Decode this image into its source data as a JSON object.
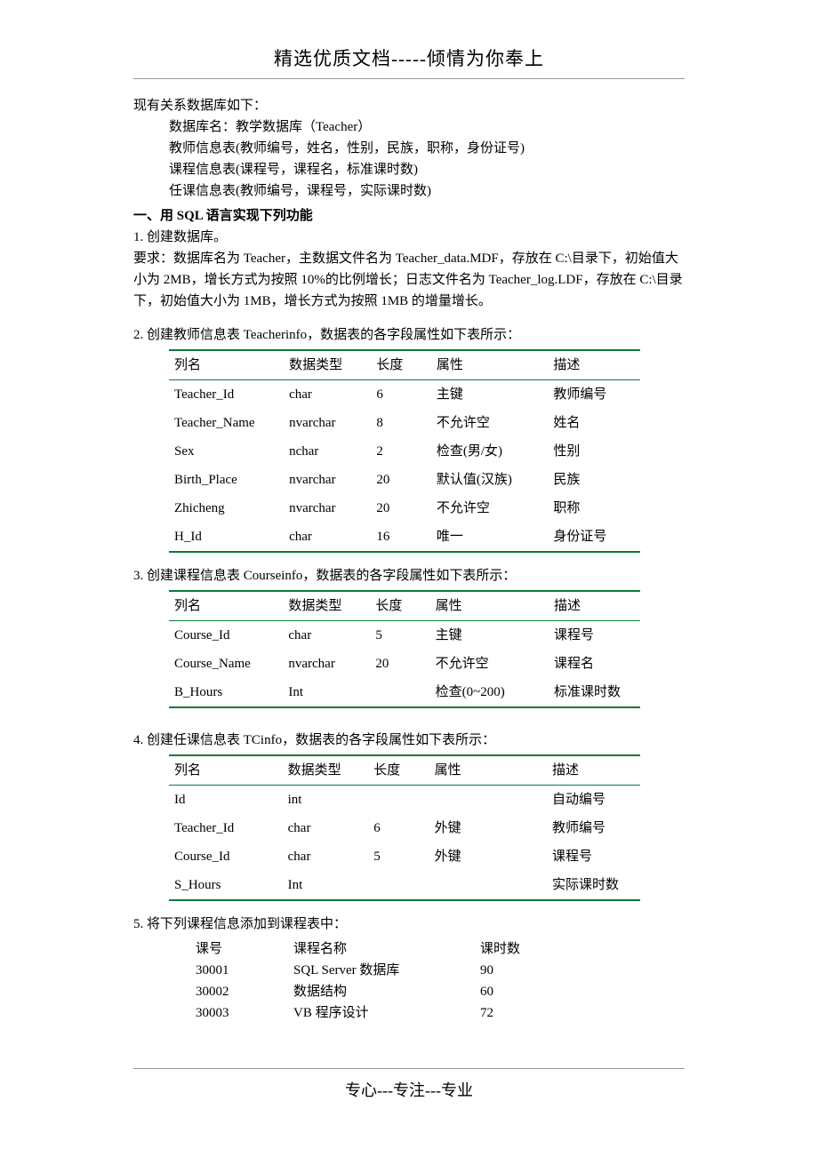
{
  "header": "精选优质文档-----倾情为你奉上",
  "intro": {
    "line1": "现有关系数据库如下：",
    "db": "数据库名：教学数据库（Teacher）",
    "tab1": "教师信息表(教师编号，姓名，性别，民族，职称，身份证号)",
    "tab2": "课程信息表(课程号，课程名，标准课时数)",
    "tab3": "任课信息表(教师编号，课程号，实际课时数)"
  },
  "section1": {
    "title": "一、用 SQL 语言实现下列功能",
    "q1_title": "1. 创建数据库。",
    "q1_body": "要求：数据库名为 Teacher，主数据文件名为 Teacher_data.MDF，存放在 C:\\目录下，初始值大小为 2MB，增长方式为按照 10%的比例增长；日志文件名为 Teacher_log.LDF，存放在 C:\\目录下，初始值大小为 1MB，增长方式为按照 1MB 的增量增长。"
  },
  "q2": {
    "title": "2. 创建教师信息表 Teacherinfo，数据表的各字段属性如下表所示：",
    "headers": [
      "列名",
      "数据类型",
      "长度",
      "属性",
      "描述"
    ],
    "rows": [
      [
        "Teacher_Id",
        "char",
        "6",
        "主键",
        "教师编号"
      ],
      [
        "Teacher_Name",
        "nvarchar",
        "8",
        "不允许空",
        "姓名"
      ],
      [
        "Sex",
        "nchar",
        "2",
        "检查(男/女)",
        "性别"
      ],
      [
        "Birth_Place",
        "nvarchar",
        "20",
        "默认值(汉族)",
        "民族"
      ],
      [
        "Zhicheng",
        "nvarchar",
        "20",
        "不允许空",
        "职称"
      ],
      [
        "H_Id",
        "char",
        "16",
        "唯一",
        "身份证号"
      ]
    ]
  },
  "q3": {
    "title": "3. 创建课程信息表 Courseinfo，数据表的各字段属性如下表所示：",
    "headers": [
      "列名",
      "数据类型",
      "长度",
      "属性",
      "描述"
    ],
    "rows": [
      [
        "Course_Id",
        "char",
        "5",
        "主键",
        "课程号"
      ],
      [
        "Course_Name",
        "nvarchar",
        "20",
        "不允许空",
        "课程名"
      ],
      [
        "B_Hours",
        "Int",
        "",
        "检查(0~200)",
        "标准课时数"
      ]
    ]
  },
  "q4": {
    "title": "4. 创建任课信息表 TCinfo，数据表的各字段属性如下表所示：",
    "headers": [
      "列名",
      "数据类型",
      "长度",
      "属性",
      "描述"
    ],
    "rows": [
      [
        "Id",
        "int",
        "",
        "",
        "自动编号"
      ],
      [
        "Teacher_Id",
        "char",
        "6",
        "外键",
        "教师编号"
      ],
      [
        "Course_Id",
        "char",
        "5",
        "外键",
        "课程号"
      ],
      [
        "S_Hours",
        "Int",
        "",
        "",
        "实际课时数"
      ]
    ]
  },
  "q5": {
    "title": "5.  将下列课程信息添加到课程表中：",
    "headers": [
      "课号",
      "课程名称",
      "课时数"
    ],
    "rows": [
      [
        "30001",
        "SQL Server 数据库",
        "90"
      ],
      [
        "30002",
        "数据结构",
        "60"
      ],
      [
        "30003",
        "VB 程序设计",
        "72"
      ]
    ]
  },
  "footer": "专心---专注---专业"
}
